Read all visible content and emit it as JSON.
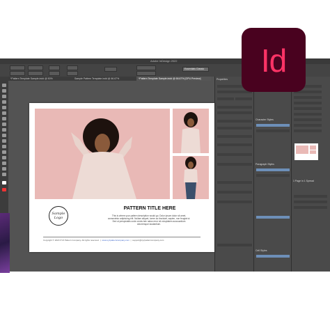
{
  "window": {
    "title": "Adobe InDesign 2022",
    "menu_items": [
      "",
      "",
      "",
      "",
      "",
      "",
      ""
    ],
    "tabs": [
      {
        "label": "*Pattern Template Sample.indd @ 50%"
      },
      {
        "label": "Sample Pattern Template.indd @ 66.67%"
      },
      {
        "label": "*Pattern Template Sample.indd @ 66.67% [GPU Preview]"
      }
    ],
    "workspace_label": "Essentials Classic"
  },
  "document": {
    "pattern_title": "PATTERN TITLE HERE",
    "description": "This is where your pattern description would go. Dolor ipsum dolor sit amet, consectetur adipiscing elit. Nullam aliquet, lorem ac tincidunt, sapien, non feugiat ut. Sed ut perspiciatis unde omnis iste natus error sit voluptatem accusantium doloremque laudantium.",
    "logo_text": "Sample Logo",
    "footer_copyright": "Copyright © 2020 XYZ Pattern Company. All rights reserved.",
    "footer_site": "www.xyzpatterncompany.com",
    "footer_email": "support@xyzpatterncompany.com"
  },
  "panels": {
    "properties_label": "Properties",
    "paragraph_styles_label": "Paragraph Styles",
    "character_styles_label": "Character Styles",
    "cell_styles_label": "Cell Styles",
    "basic_paragraph": "[Basic Paragraph]",
    "basic_character": "[None]",
    "pages_label": "Pages",
    "layers_label": "Layers",
    "links_label": "Links",
    "swatches_label": "Swatches",
    "page_count": "1 Page in 1 Spread",
    "right_list": [
      "Pages",
      "Layers",
      "Links",
      "Stroke",
      "Swatches",
      "Gradient",
      "Effects",
      "Color",
      "Text Wrap",
      "Align",
      "Paragraph Styles",
      "Character Styles",
      "Object Styles",
      "Table Styles",
      "Cell Styles"
    ]
  },
  "badge": {
    "text": "Id",
    "bg_color": "#49021f",
    "fg_color": "#ff3366"
  }
}
